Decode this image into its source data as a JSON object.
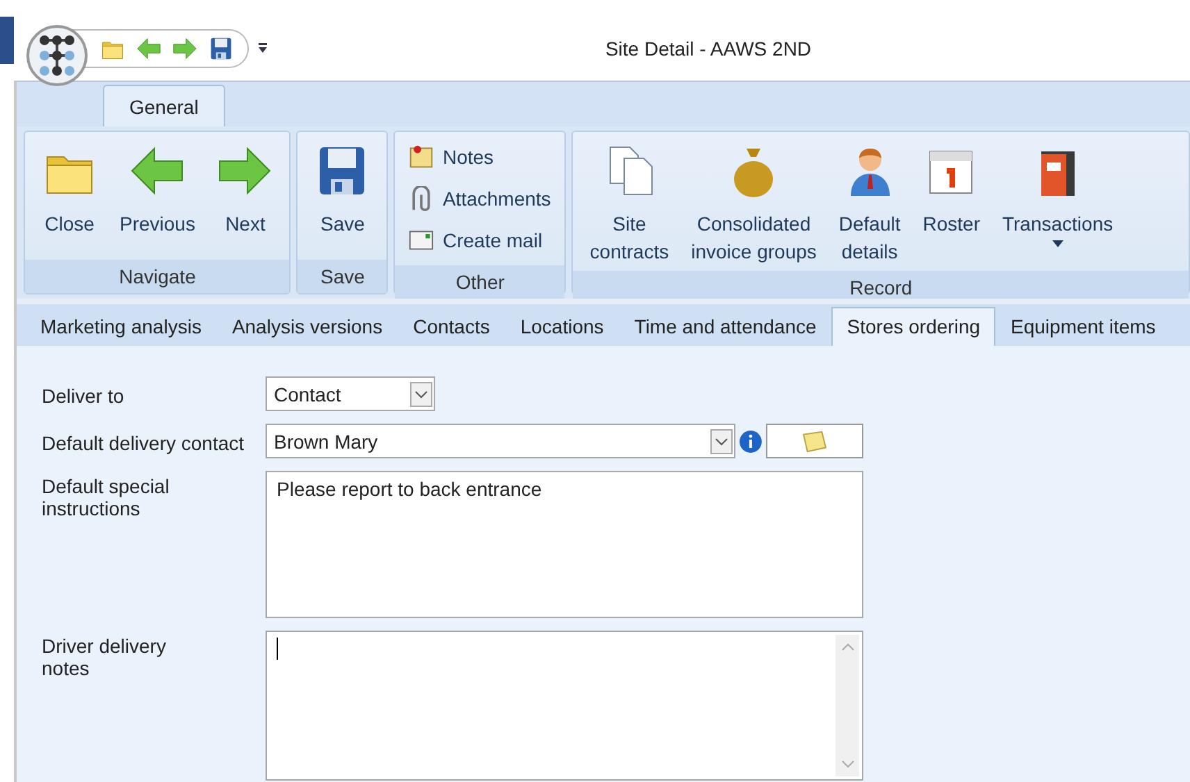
{
  "window": {
    "title": "Site Detail - AAWS 2ND"
  },
  "ribbon_tabs": [
    {
      "label": "General",
      "selected": true
    }
  ],
  "ribbon_groups": [
    {
      "label": "Navigate",
      "items": [
        {
          "kind": "large",
          "lines": [
            "Close"
          ]
        },
        {
          "kind": "large",
          "lines": [
            "Previous"
          ]
        },
        {
          "kind": "large",
          "lines": [
            "Next"
          ]
        }
      ]
    },
    {
      "label": "Save",
      "items": [
        {
          "kind": "large",
          "lines": [
            "Save"
          ]
        }
      ]
    },
    {
      "label": "Other",
      "items": [
        {
          "kind": "small",
          "lines": [
            "Notes"
          ]
        },
        {
          "kind": "small",
          "lines": [
            "Attachments"
          ]
        },
        {
          "kind": "small",
          "lines": [
            "Create mail"
          ]
        }
      ]
    },
    {
      "label": "Record",
      "items": [
        {
          "kind": "large",
          "lines": [
            "Site",
            "contracts"
          ]
        },
        {
          "kind": "large",
          "lines": [
            "Consolidated",
            "invoice groups"
          ]
        },
        {
          "kind": "large",
          "lines": [
            "Default",
            "details"
          ]
        },
        {
          "kind": "large",
          "lines": [
            "Roster"
          ]
        },
        {
          "kind": "large",
          "lines": [
            "Transactions"
          ],
          "dropdown": true
        }
      ]
    }
  ],
  "doc_tabs": [
    {
      "label": "Marketing analysis",
      "selected": false
    },
    {
      "label": "Analysis versions",
      "selected": false
    },
    {
      "label": "Contacts",
      "selected": false
    },
    {
      "label": "Locations",
      "selected": false
    },
    {
      "label": "Time and attendance",
      "selected": false
    },
    {
      "label": "Stores ordering",
      "selected": true
    },
    {
      "label": "Equipment items",
      "selected": false
    }
  ],
  "form": [
    {
      "kind": "select",
      "label": "Deliver to",
      "value": "Contact"
    },
    {
      "kind": "combo",
      "label": "Default delivery contact",
      "value": "Brown Mary"
    },
    {
      "kind": "textarea",
      "label": "Default special instructions",
      "value": "Please report to back entrance",
      "focused": false,
      "scrollbar": false
    },
    {
      "kind": "textarea",
      "label": "Driver delivery notes",
      "focused": true,
      "scrollbar": true
    }
  ]
}
